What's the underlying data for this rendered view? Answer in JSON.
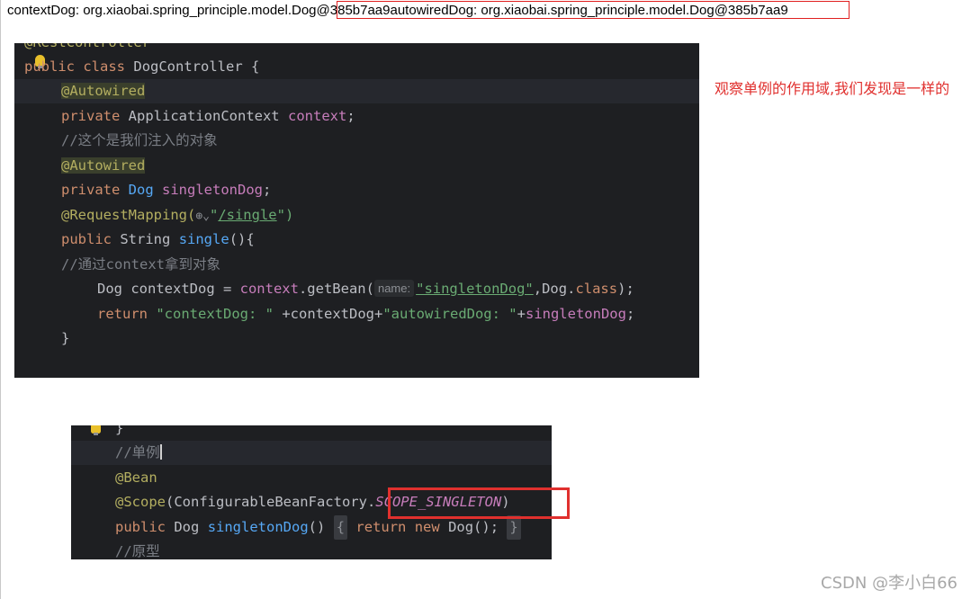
{
  "output": {
    "before_box": "contextDog: org.xiaobai.spring_principle.model.Dog",
    "boxed": "@385b7aa9autowiredDog: org.xiaobai.spring_principle.model.Dog@385b7aa9"
  },
  "editor1": {
    "annotation_cut": "@RestController",
    "class_kw1": "public",
    "class_kw2": "class",
    "class_name": "DogController {",
    "autowired": "@Autowired",
    "private": "private",
    "app_ctx_type": "ApplicationContext",
    "context_field": "context",
    "semicolon": ";",
    "comment_inject": "//这个是我们注入的对象",
    "dog_type": "Dog",
    "singleton_field": "singletonDog",
    "request_mapping": "@RequestMapping(",
    "globe": "⊕⌄",
    "url_quote_open": "\"",
    "url": "/single",
    "url_quote_close": "\")",
    "public": "public",
    "string_type": "String",
    "method_single": "single",
    "method_tail": "(){",
    "comment_context": "//通过context拿到对象",
    "dog_decl": "Dog contextDog = ",
    "context_call": "context",
    "get_bean": ".getBean(",
    "hint_name": "name:",
    "bean_name_str": "\"singletonDog\"",
    "dog_class_tail": ",Dog.",
    "class_kw": "class",
    "close_call": ");",
    "return_kw": "return",
    "str_context": "\"contextDog: \"",
    "concat1": " +contextDog+",
    "str_autowired": "\"autowiredDog: \"",
    "concat2": "+",
    "singleton_ref": "singletonDog",
    "end_semicolon": ";",
    "close_brace": "}"
  },
  "editor2": {
    "brace": "}",
    "comment_singleton": "//单例",
    "bean": "@Bean",
    "scope_open": "@Scope",
    "scope_factory": "(ConfigurableBeanFactory.",
    "scope_const": "SCOPE_SINGLETON",
    "scope_close": ")",
    "public": "public",
    "dog_type": "Dog",
    "method": "singletonDog",
    "parens": "()",
    "fold_open": "{",
    "return_kw": "return",
    "new_kw": "new",
    "new_dog": "Dog();",
    "fold_close": "}",
    "comment_prototype": "//原型"
  },
  "note": "观察单例的作用域,我们发现是一样的",
  "watermark": "CSDN @李小白66",
  "colors": {
    "editor_bg": "#1e1f22",
    "highlight_red": "#e0302e"
  }
}
